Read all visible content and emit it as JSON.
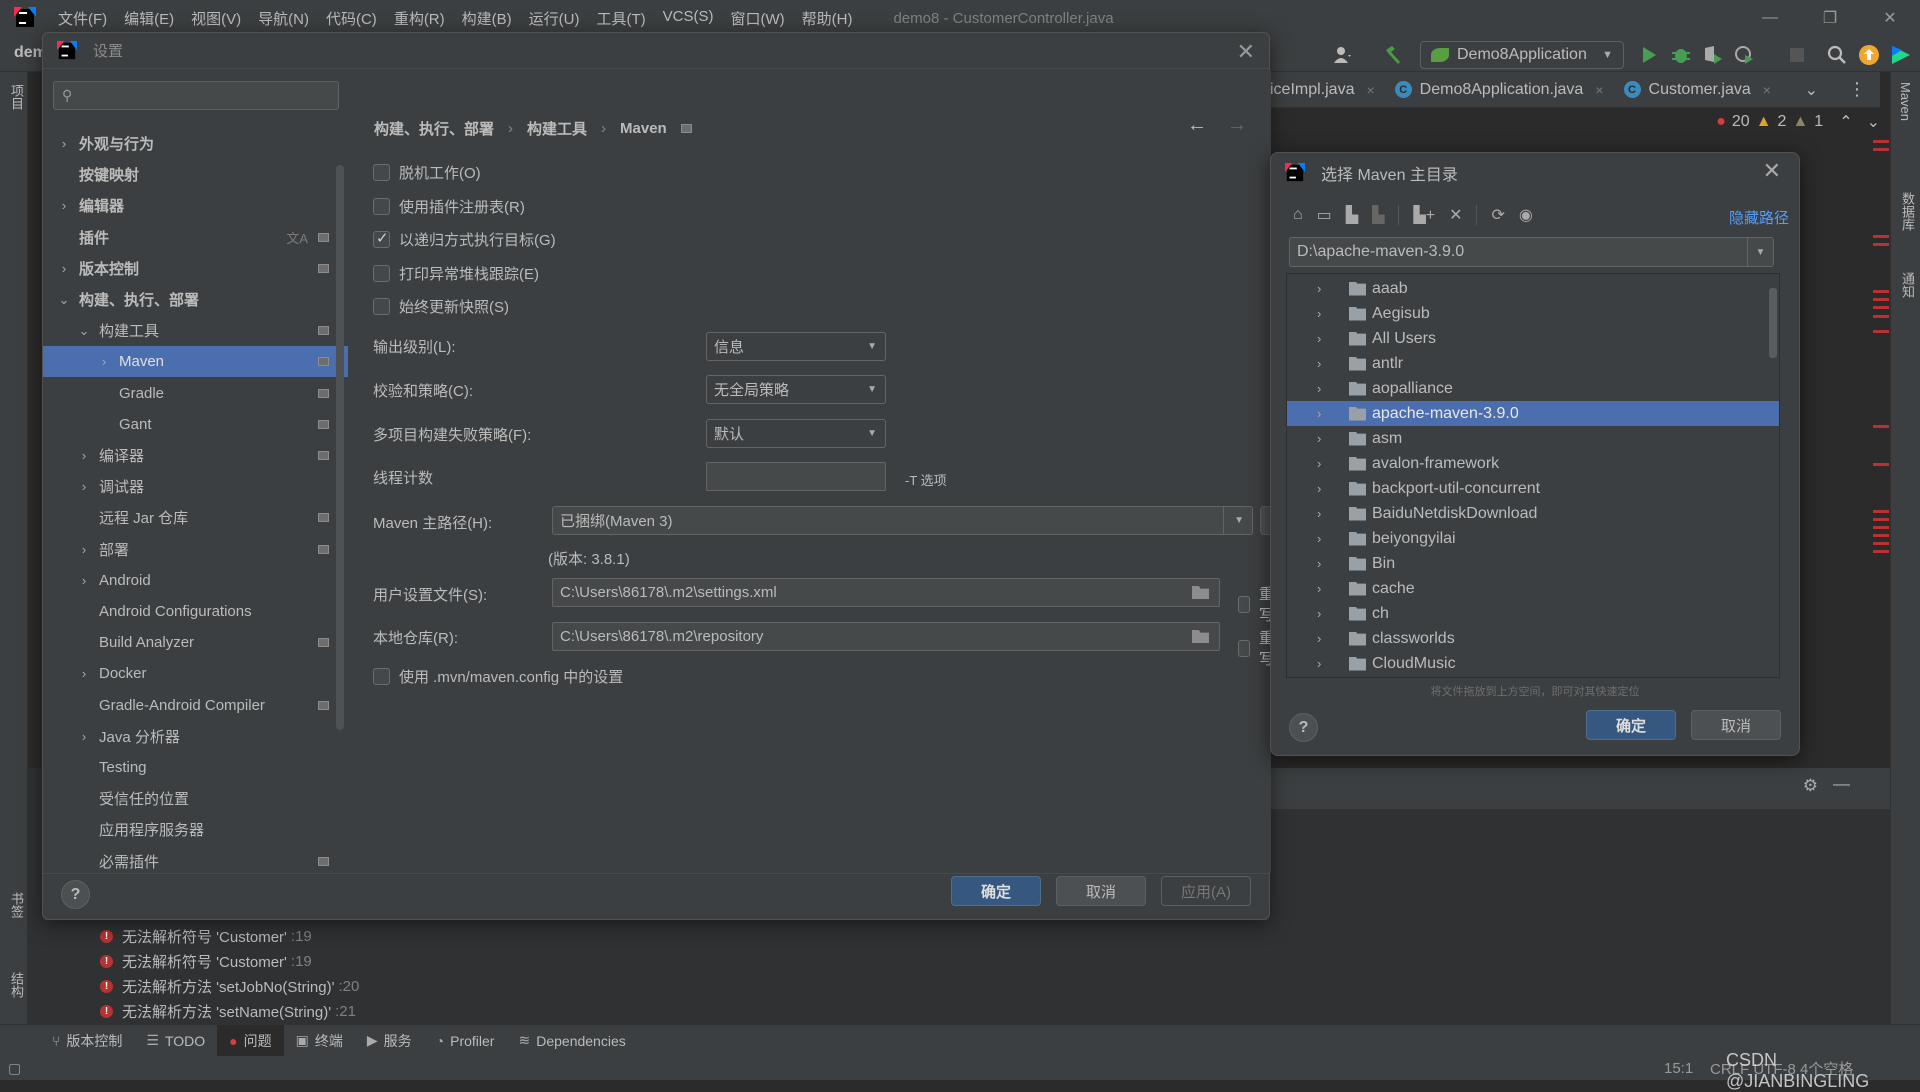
{
  "menubar": {
    "items": [
      "文件(F)",
      "编辑(E)",
      "视图(V)",
      "导航(N)",
      "代码(C)",
      "重构(R)",
      "构建(B)",
      "运行(U)",
      "工具(T)",
      "VCS(S)",
      "窗口(W)",
      "帮助(H)"
    ],
    "window_title": "demo8 - CustomerController.java",
    "window_controls": [
      "—",
      "❐",
      "✕"
    ]
  },
  "toolbar": {
    "project_label": "dem",
    "run_config": "Demo8Application"
  },
  "editor": {
    "tabs": [
      {
        "label": "iceImpl.java",
        "icon": "class-icon"
      },
      {
        "label": "Demo8Application.java",
        "icon": "spring-app-icon"
      },
      {
        "label": "Customer.java",
        "icon": "class-icon"
      }
    ],
    "inspections": {
      "errors": "20",
      "warnings": "2",
      "weak_warnings": "1"
    }
  },
  "right_strip": {
    "items": [
      "Maven",
      "数据库",
      "通知"
    ]
  },
  "left_strip": {
    "items": [
      "项目",
      "书签",
      "结构"
    ]
  },
  "settings": {
    "title": "设置",
    "search_placeholder": "",
    "sidebar": [
      {
        "label": "外观与行为",
        "level": 0,
        "arrow": "›",
        "bold": true
      },
      {
        "label": "按键映射",
        "level": 0,
        "arrow": "",
        "bold": true
      },
      {
        "label": "编辑器",
        "level": 0,
        "arrow": "›",
        "bold": true
      },
      {
        "label": "插件",
        "level": 0,
        "arrow": "",
        "bold": true,
        "translate": true,
        "pin": true
      },
      {
        "label": "版本控制",
        "level": 0,
        "arrow": "›",
        "bold": true,
        "pin": true
      },
      {
        "label": "构建、执行、部署",
        "level": 0,
        "arrow": "⌄",
        "bold": true
      },
      {
        "label": "构建工具",
        "level": 1,
        "arrow": "⌄",
        "pin": true
      },
      {
        "label": "Maven",
        "level": 2,
        "arrow": "›",
        "pin": true,
        "selected": true
      },
      {
        "label": "Gradle",
        "level": 2,
        "arrow": "",
        "pin": true
      },
      {
        "label": "Gant",
        "level": 2,
        "arrow": "",
        "pin": true
      },
      {
        "label": "编译器",
        "level": 1,
        "arrow": "›",
        "pin": true
      },
      {
        "label": "调试器",
        "level": 1,
        "arrow": "›"
      },
      {
        "label": "远程 Jar 仓库",
        "level": 1,
        "arrow": "",
        "pin": true
      },
      {
        "label": "部署",
        "level": 1,
        "arrow": "›",
        "pin": true
      },
      {
        "label": "Android",
        "level": 1,
        "arrow": "›"
      },
      {
        "label": "Android Configurations",
        "level": 1,
        "arrow": ""
      },
      {
        "label": "Build Analyzer",
        "level": 1,
        "arrow": "",
        "pin": true
      },
      {
        "label": "Docker",
        "level": 1,
        "arrow": "›"
      },
      {
        "label": "Gradle-Android Compiler",
        "level": 1,
        "arrow": "",
        "pin": true
      },
      {
        "label": "Java 分析器",
        "level": 1,
        "arrow": "›"
      },
      {
        "label": "Testing",
        "level": 1,
        "arrow": ""
      },
      {
        "label": "受信任的位置",
        "level": 1,
        "arrow": ""
      },
      {
        "label": "应用程序服务器",
        "level": 1,
        "arrow": ""
      },
      {
        "label": "必需插件",
        "level": 1,
        "arrow": "",
        "pin": true
      }
    ],
    "breadcrumb": [
      "构建、执行、部署",
      "构建工具",
      "Maven"
    ],
    "checkboxes": [
      {
        "label": "脱机工作(O)",
        "checked": false
      },
      {
        "label": "使用插件注册表(R)",
        "checked": false
      },
      {
        "label": "以递归方式执行目标(G)",
        "checked": true
      },
      {
        "label": "打印异常堆栈跟踪(E)",
        "checked": false
      },
      {
        "label": "始终更新快照(S)",
        "checked": false
      }
    ],
    "output_level": {
      "label": "输出级别(L):",
      "value": "信息"
    },
    "checksum_policy": {
      "label": "校验和策略(C):",
      "value": "无全局策略"
    },
    "multiproject_fail_policy": {
      "label": "多项目构建失败策略(F):",
      "value": "默认"
    },
    "thread_count": {
      "label": "线程计数",
      "value": "",
      "hint": "-T 选项"
    },
    "maven_home": {
      "label": "Maven 主路径(H):",
      "value": "已捆绑(Maven 3)",
      "browse": "...",
      "version": "(版本: 3.8.1)"
    },
    "user_settings": {
      "label": "用户设置文件(S):",
      "value": "C:\\Users\\86178\\.m2\\settings.xml",
      "override_label": "重写",
      "override": false
    },
    "local_repo": {
      "label": "本地仓库(R):",
      "value": "C:\\Users\\86178\\.m2\\repository",
      "override_label": "重写",
      "override": false
    },
    "mvn_config": {
      "label": "使用 .mvn/maven.config 中的设置",
      "checked": false
    },
    "buttons": {
      "ok": "确定",
      "cancel": "取消",
      "apply": "应用(A)",
      "help": "?"
    }
  },
  "chooser": {
    "title": "选择 Maven 主目录",
    "hide_path": "隐藏路径",
    "path": "D:\\apache-maven-3.9.0",
    "folders": [
      {
        "name": "aaab"
      },
      {
        "name": "Aegisub"
      },
      {
        "name": "All Users"
      },
      {
        "name": "antlr"
      },
      {
        "name": "aopalliance"
      },
      {
        "name": "apache-maven-3.9.0",
        "selected": true
      },
      {
        "name": "asm"
      },
      {
        "name": "avalon-framework"
      },
      {
        "name": "backport-util-concurrent"
      },
      {
        "name": "BaiduNetdiskDownload"
      },
      {
        "name": "beiyongyilai"
      },
      {
        "name": "Bin"
      },
      {
        "name": "cache"
      },
      {
        "name": "ch"
      },
      {
        "name": "classworlds"
      },
      {
        "name": "CloudMusic"
      }
    ],
    "drop_hint": "将文件拖放到上方空间，即可对其快速定位",
    "buttons": {
      "ok": "确定",
      "cancel": "取消",
      "help": "?"
    }
  },
  "problems": [
    {
      "text": "无法解析符号 'Customer'",
      "line": ":19"
    },
    {
      "text": "无法解析符号 'Customer'",
      "line": ":19"
    },
    {
      "text": "无法解析方法 'setJobNo(String)'",
      "line": ":20"
    },
    {
      "text": "无法解析方法 'setName(String)'",
      "line": ":21"
    }
  ],
  "bottom_tabs": [
    {
      "label": "版本控制",
      "glyph": "⑂"
    },
    {
      "label": "TODO",
      "glyph": "☰"
    },
    {
      "label": "问题",
      "glyph": "●",
      "active": true
    },
    {
      "label": "终端",
      "glyph": "▣"
    },
    {
      "label": "服务",
      "glyph": "▶"
    },
    {
      "label": "Profiler",
      "glyph": "◔"
    },
    {
      "label": "Dependencies",
      "glyph": "≋"
    }
  ],
  "statusbar": {
    "position": "15:1",
    "encoding": "CRLF  UTF-8  4个空格",
    "watermark": "CSDN @JIANBINGLING"
  }
}
